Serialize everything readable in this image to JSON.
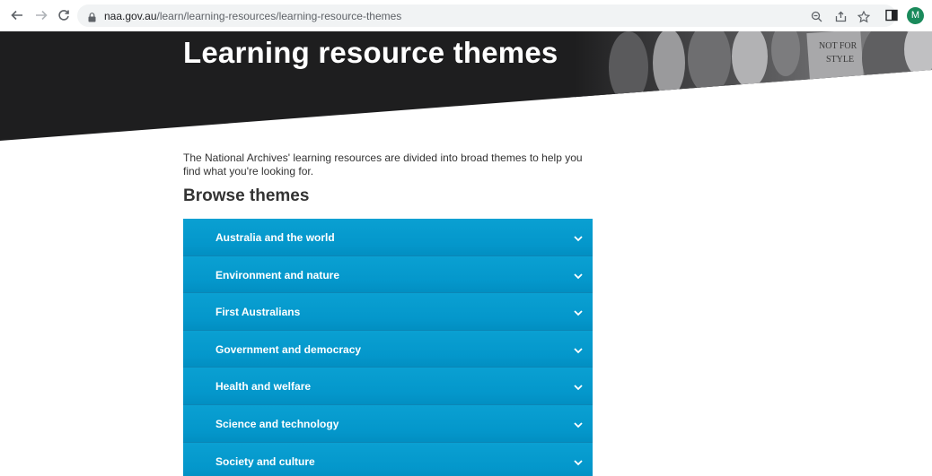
{
  "browser": {
    "url_host": "naa.gov.au",
    "url_path": "/learn/learning-resources/learning-resource-themes",
    "avatar_letter": "M"
  },
  "hero": {
    "title": "Learning resource themes",
    "sign_text_line1": "NOT FOR",
    "sign_text_line2": "STYLE"
  },
  "intro": {
    "text": "The National Archives' learning resources are divided into broad themes to help you find what you're looking for."
  },
  "browse": {
    "heading": "Browse themes",
    "items": [
      {
        "label": "Australia and the world"
      },
      {
        "label": "Environment and nature"
      },
      {
        "label": "First Australians"
      },
      {
        "label": "Government and democracy"
      },
      {
        "label": "Health and welfare"
      },
      {
        "label": "Science and technology"
      },
      {
        "label": "Society and culture"
      }
    ]
  },
  "colors": {
    "accordion": "#049acc",
    "hero_bg": "#1e1e1f",
    "avatar": "#1a8a5b"
  }
}
